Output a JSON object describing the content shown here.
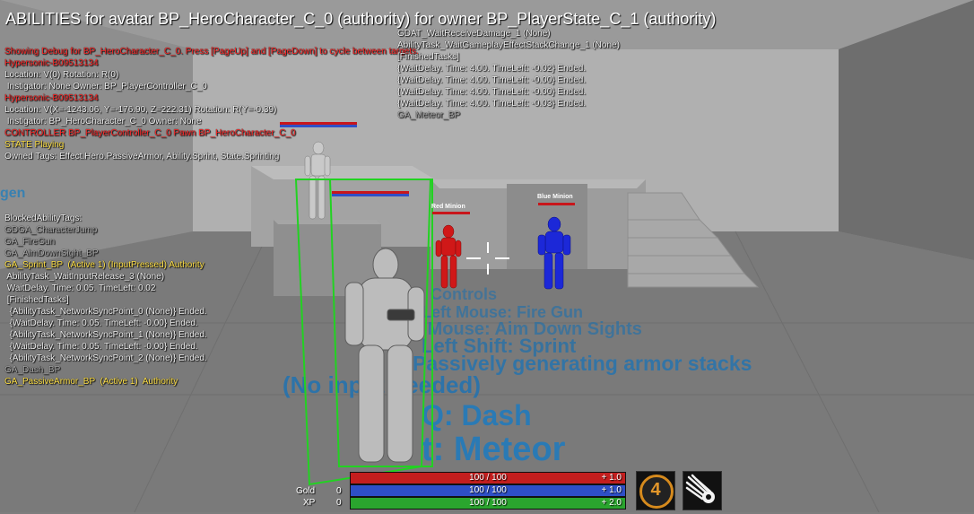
{
  "title": "ABILITIES for avatar BP_HeroCharacter_C_0 (authority) for owner BP_PlayerState_C_1 (authority)",
  "debug_left": [
    {
      "text": "Showing Debug for BP_HeroCharacter_C_0. Press [PageUp] and [PageDown] to cycle between targets.",
      "color": "red"
    },
    {
      "text": "Hypersonic-B09513134",
      "color": "red"
    },
    {
      "text": "Location: V(0) Rotation: R(0)",
      "color": "white"
    },
    {
      "text": " Instigator: None Owner: BP_PlayerController_C_0",
      "color": "white"
    },
    {
      "text": "Hypersonic-B09513134",
      "color": "red"
    },
    {
      "text": "Location: V(X=-1243.06, Y=-176.90, Z=222.31) Rotation: R(Y=-0.39)",
      "color": "white"
    },
    {
      "text": " Instigator: BP_HeroCharacter_C_0 Owner: None",
      "color": "white"
    },
    {
      "text": "CONTROLLER BP_PlayerController_C_0 Pawn BP_HeroCharacter_C_0",
      "color": "red"
    },
    {
      "text": "STATE Playing",
      "color": "yellow"
    },
    {
      "text": "Owned Tags: Effect.Hero.PassiveArmor, Ability.Sprint, State.Sprinting",
      "color": "white"
    }
  ],
  "blocked_tags": [
    {
      "text": "BlockedAbilityTags:",
      "color": "white"
    },
    {
      "text": "GDGA_CharacterJump",
      "color": "gray"
    },
    {
      "text": "GA_FireGun",
      "color": "gray"
    },
    {
      "text": "GA_AimDownSight_BP",
      "color": "gray"
    },
    {
      "text": "GA_Sprint_BP  (Active 1) (InputPressed) Authority",
      "color": "yellow"
    },
    {
      "text": " AbilityTask_WaitInputRelease_3 (None)",
      "color": "white"
    },
    {
      "text": " WaitDelay. Time: 0.05. TimeLeft: 0.02",
      "color": "white"
    },
    {
      "text": " [FinishedTasks]",
      "color": "white"
    },
    {
      "text": "  {AbilityTask_NetworkSyncPoint_0 (None)} Ended.",
      "color": "white"
    },
    {
      "text": "  {WaitDelay. Time: 0.05. TimeLeft: -0.00} Ended.",
      "color": "white"
    },
    {
      "text": "  {AbilityTask_NetworkSyncPoint_1 (None)} Ended.",
      "color": "white"
    },
    {
      "text": "  {WaitDelay. Time: 0.05. TimeLeft: -0.00} Ended.",
      "color": "white"
    },
    {
      "text": "  {AbilityTask_NetworkSyncPoint_2 (None)} Ended.",
      "color": "white"
    },
    {
      "text": "GA_Dash_BP",
      "color": "gray"
    },
    {
      "text": "GA_PassiveArmor_BP  (Active 1)  Authority",
      "color": "yellow"
    }
  ],
  "debug_right": [
    {
      "text": "GDAT_WaitReceiveDamage_1 (None)",
      "color": "white"
    },
    {
      "text": "AbilityTask_WaitGameplayEffectStackChange_1 (None)",
      "color": "white"
    },
    {
      "text": "[FinishedTasks]",
      "color": "white"
    },
    {
      "text": "{WaitDelay. Time: 4.00. TimeLeft: -0.02} Ended.",
      "color": "white"
    },
    {
      "text": "{WaitDelay. Time: 4.00. TimeLeft: -0.00} Ended.",
      "color": "white"
    },
    {
      "text": "{WaitDelay. Time: 4.00. TimeLeft: -0.00} Ended.",
      "color": "white"
    },
    {
      "text": "{WaitDelay. Time: 4.00. TimeLeft: -0.03} Ended.",
      "color": "white"
    },
    {
      "text": "GA_Meteor_BP",
      "color": "gray"
    }
  ],
  "floor_text": {
    "dash": "Q: Dash",
    "meteor": "t: Meteor",
    "passive": "Passively generating armor stacks",
    "no_input": "(No input needed)",
    "sprint": "Left Shift: Sprint",
    "aim": "Right Mouse: Aim Down Sights",
    "fire": "Left Mouse: Fire Gun",
    "controls": "Controls"
  },
  "wall_sign": "gen",
  "minions": {
    "red_label": "Red Minion",
    "blue_label": "Blue Minion"
  },
  "hud": {
    "gold_label": "Gold",
    "gold_value": "0",
    "xp_label": "XP",
    "xp_value": "0",
    "health": {
      "text": "100 / 100",
      "regen": "+ 1.0",
      "fraction": 1.0,
      "color": "#c41e1e"
    },
    "mana": {
      "text": "100 / 100",
      "regen": "+ 1.0",
      "fraction": 1.0,
      "color": "#2e4fc7"
    },
    "stamina": {
      "text": "100 / 100",
      "regen": "+ 2.0",
      "fraction": 1.0,
      "color": "#2aa52e"
    },
    "ability_slot_1_value": "4",
    "ability_slot_1_icon": "clock-ring-icon",
    "ability_slot_2_icon": "meteor-icon"
  }
}
